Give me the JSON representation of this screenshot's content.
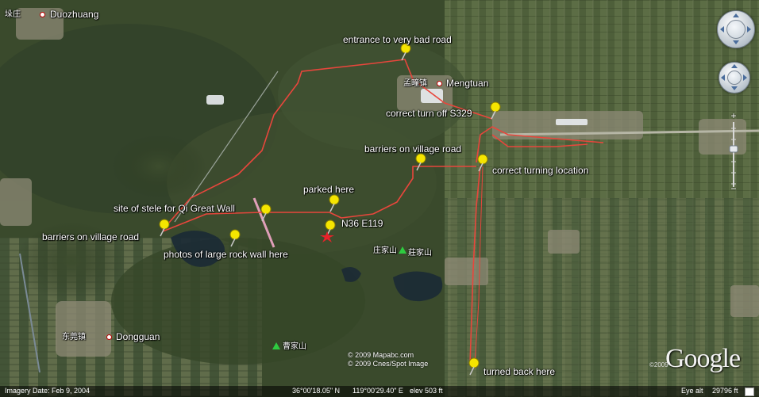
{
  "map": {
    "place_labels": [
      {
        "cn": "垛庄",
        "name": "Duozhuang"
      },
      {
        "cn": "孟疃镇",
        "name": "Mengtuan"
      },
      {
        "cn": "东莞镇",
        "name": "Dongguan"
      }
    ],
    "mountains": [
      {
        "cn1": "庄家山",
        "cn2": "莊家山"
      },
      {
        "cn1": "曹家山"
      }
    ],
    "annotations": {
      "entrance": "entrance to very bad road",
      "correct_turn_off": "correct turn off S329",
      "barriers_village_right": "barriers on village road",
      "correct_turning_location": "correct turning location",
      "parked": "parked  here",
      "stele": "site of stele for Qi Great Wall",
      "coord": "N36 E119",
      "barriers_village_left": "barriers on village road",
      "photos": "photos of large rock wall here",
      "turned_back": "turned back here"
    },
    "pin_color": "#f5e500",
    "route_color": "#e8463c",
    "target_marker_color": "#e8222a"
  },
  "copyright": {
    "mapabc": "© 2009 Mapabc.com",
    "cnes": "© 2009 Cnes/Spot Image"
  },
  "logo": {
    "text": "Google",
    "year": "©2009"
  },
  "status_bar": {
    "imagery_date": "Imagery Date: Feb  9, 2004",
    "lat": "36°00'18.05\" N",
    "lon": "119°00'29.40\" E",
    "elev": "elev   503 ft",
    "eye_alt_label": "Eye alt",
    "eye_alt_value": "29796 ft"
  },
  "controls": {
    "nav_icon": "look-navigation-icon",
    "move_icon": "move-navigation-icon",
    "zoom_in": "+",
    "zoom_out": "−"
  }
}
